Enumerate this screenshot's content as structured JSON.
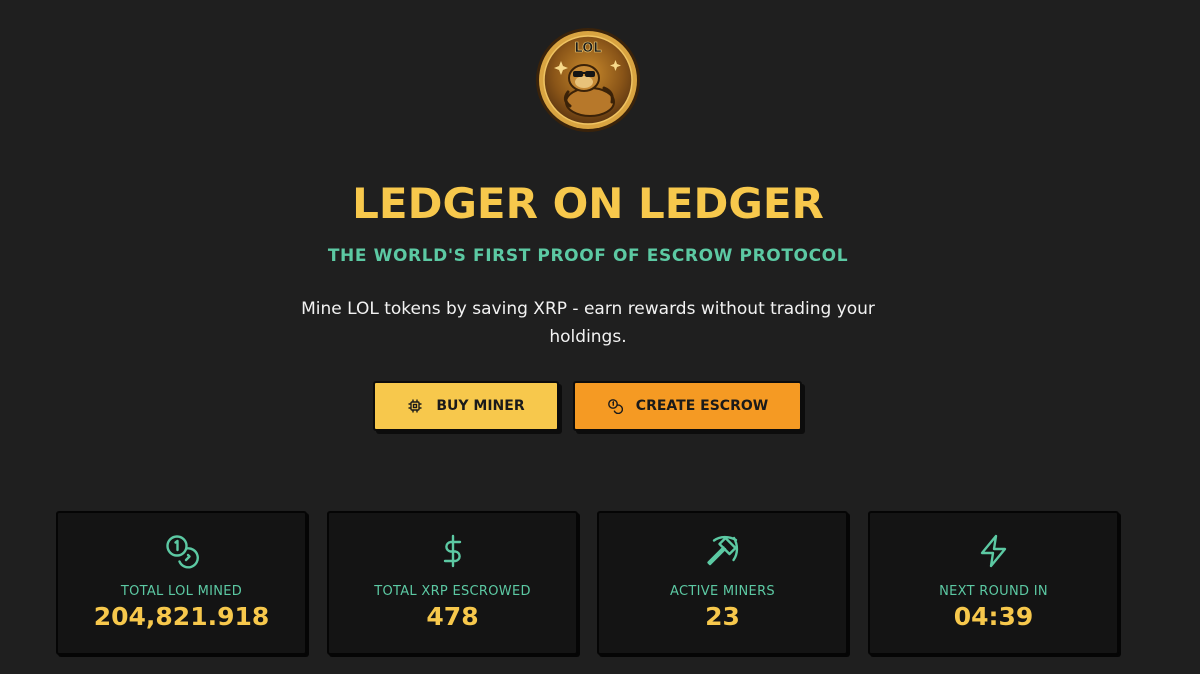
{
  "brand": {
    "logo_text": "LOL",
    "logo_icon": "sloth-coin-icon"
  },
  "hero": {
    "title": "LEDGER ON LEDGER",
    "subtitle": "THE WORLD'S FIRST PROOF OF ESCROW PROTOCOL",
    "tagline": "Mine LOL tokens by saving XRP - earn rewards without trading your holdings."
  },
  "actions": {
    "buy_miner": {
      "label": "BUY MINER",
      "icon": "cpu-chip-icon"
    },
    "create_escrow": {
      "label": "CREATE ESCROW",
      "icon": "coins-icon"
    }
  },
  "stats": [
    {
      "label": "TOTAL LOL MINED",
      "value": "204,821.918",
      "icon": "coins-icon"
    },
    {
      "label": "TOTAL XRP ESCROWED",
      "value": "478",
      "icon": "dollar-icon"
    },
    {
      "label": "ACTIVE MINERS",
      "value": "23",
      "icon": "pickaxe-icon"
    },
    {
      "label": "NEXT ROUND IN",
      "value": "04:39",
      "icon": "lightning-icon"
    }
  ],
  "colors": {
    "background": "#1f1f1f",
    "gold": "#f7c84c",
    "orange": "#f59a23",
    "teal": "#5cc9a3",
    "card": "#141414"
  }
}
